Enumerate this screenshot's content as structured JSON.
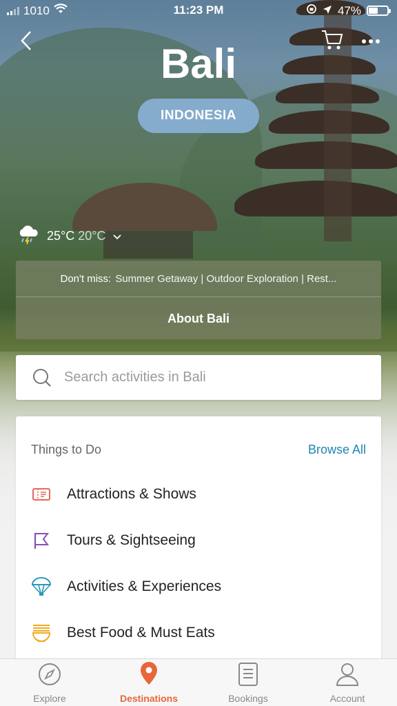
{
  "status_bar": {
    "carrier": "1010",
    "time": "11:23 PM",
    "battery": "47%"
  },
  "header": {
    "title": "Bali",
    "country": "INDONESIA"
  },
  "weather": {
    "high": "25°C",
    "low": "20°C"
  },
  "dont_miss": {
    "label": "Don't miss:",
    "items": "Summer Getaway | Outdoor Exploration | Rest..."
  },
  "about": {
    "label": "About Bali"
  },
  "search": {
    "placeholder": "Search activities in Bali"
  },
  "things_to_do": {
    "heading": "Things to Do",
    "browse_all": "Browse All",
    "categories": [
      {
        "label": "Attractions & Shows",
        "icon": "ticket-icon",
        "color": "#e8665c"
      },
      {
        "label": "Tours & Sightseeing",
        "icon": "flag-icon",
        "color": "#8a4fb5"
      },
      {
        "label": "Activities & Experiences",
        "icon": "parachute-icon",
        "color": "#2a9bb8"
      },
      {
        "label": "Best Food & Must Eats",
        "icon": "noodles-icon",
        "color": "#f2a81d"
      }
    ]
  },
  "tabs": [
    {
      "label": "Explore",
      "icon": "compass-icon",
      "active": false
    },
    {
      "label": "Destinations",
      "icon": "map-pin-icon",
      "active": true
    },
    {
      "label": "Bookings",
      "icon": "document-icon",
      "active": false
    },
    {
      "label": "Account",
      "icon": "user-icon",
      "active": false
    }
  ],
  "colors": {
    "accent": "#e8663a",
    "link": "#1f86b3",
    "pill": "#89b0d6"
  }
}
